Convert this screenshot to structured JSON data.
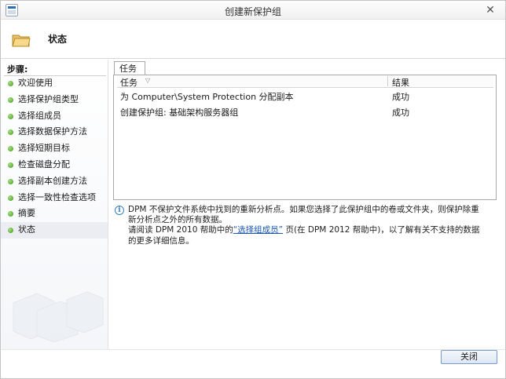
{
  "window": {
    "title": "创建新保护组"
  },
  "header": {
    "title": "状态"
  },
  "steps": {
    "heading": "步骤:",
    "items": [
      {
        "label": "欢迎使用"
      },
      {
        "label": "选择保护组类型"
      },
      {
        "label": "选择组成员"
      },
      {
        "label": "选择数据保护方法"
      },
      {
        "label": "选择短期目标"
      },
      {
        "label": "检查磁盘分配"
      },
      {
        "label": "选择副本创建方法"
      },
      {
        "label": "选择一致性检查选项"
      },
      {
        "label": "摘要"
      },
      {
        "label": "状态"
      }
    ],
    "current_index": 9
  },
  "tab": {
    "label": "任务"
  },
  "grid": {
    "columns": [
      "任务",
      "结果"
    ],
    "rows": [
      {
        "task": "为 Computer\\System Protection 分配副本",
        "result": "成功"
      },
      {
        "task": "创建保护组: 基础架构服务器组",
        "result": "成功"
      }
    ]
  },
  "info": {
    "line1": "DPM 不保护文件系统中找到的重新分析点。如果您选择了此保护组中的卷或文件夹，则保护除重新分析点之外的所有数据。",
    "line2_prefix": "请阅读 DPM 2010 帮助中的",
    "link_text": "“选择组成员”",
    "line2_suffix": " 页(在 DPM 2012 帮助中)，以了解有关不支持的数据的更多详细信息。"
  },
  "buttons": {
    "close": "关闭"
  },
  "colors": {
    "accent": "#1a55b4",
    "step_dot": "#3c9a1e"
  }
}
